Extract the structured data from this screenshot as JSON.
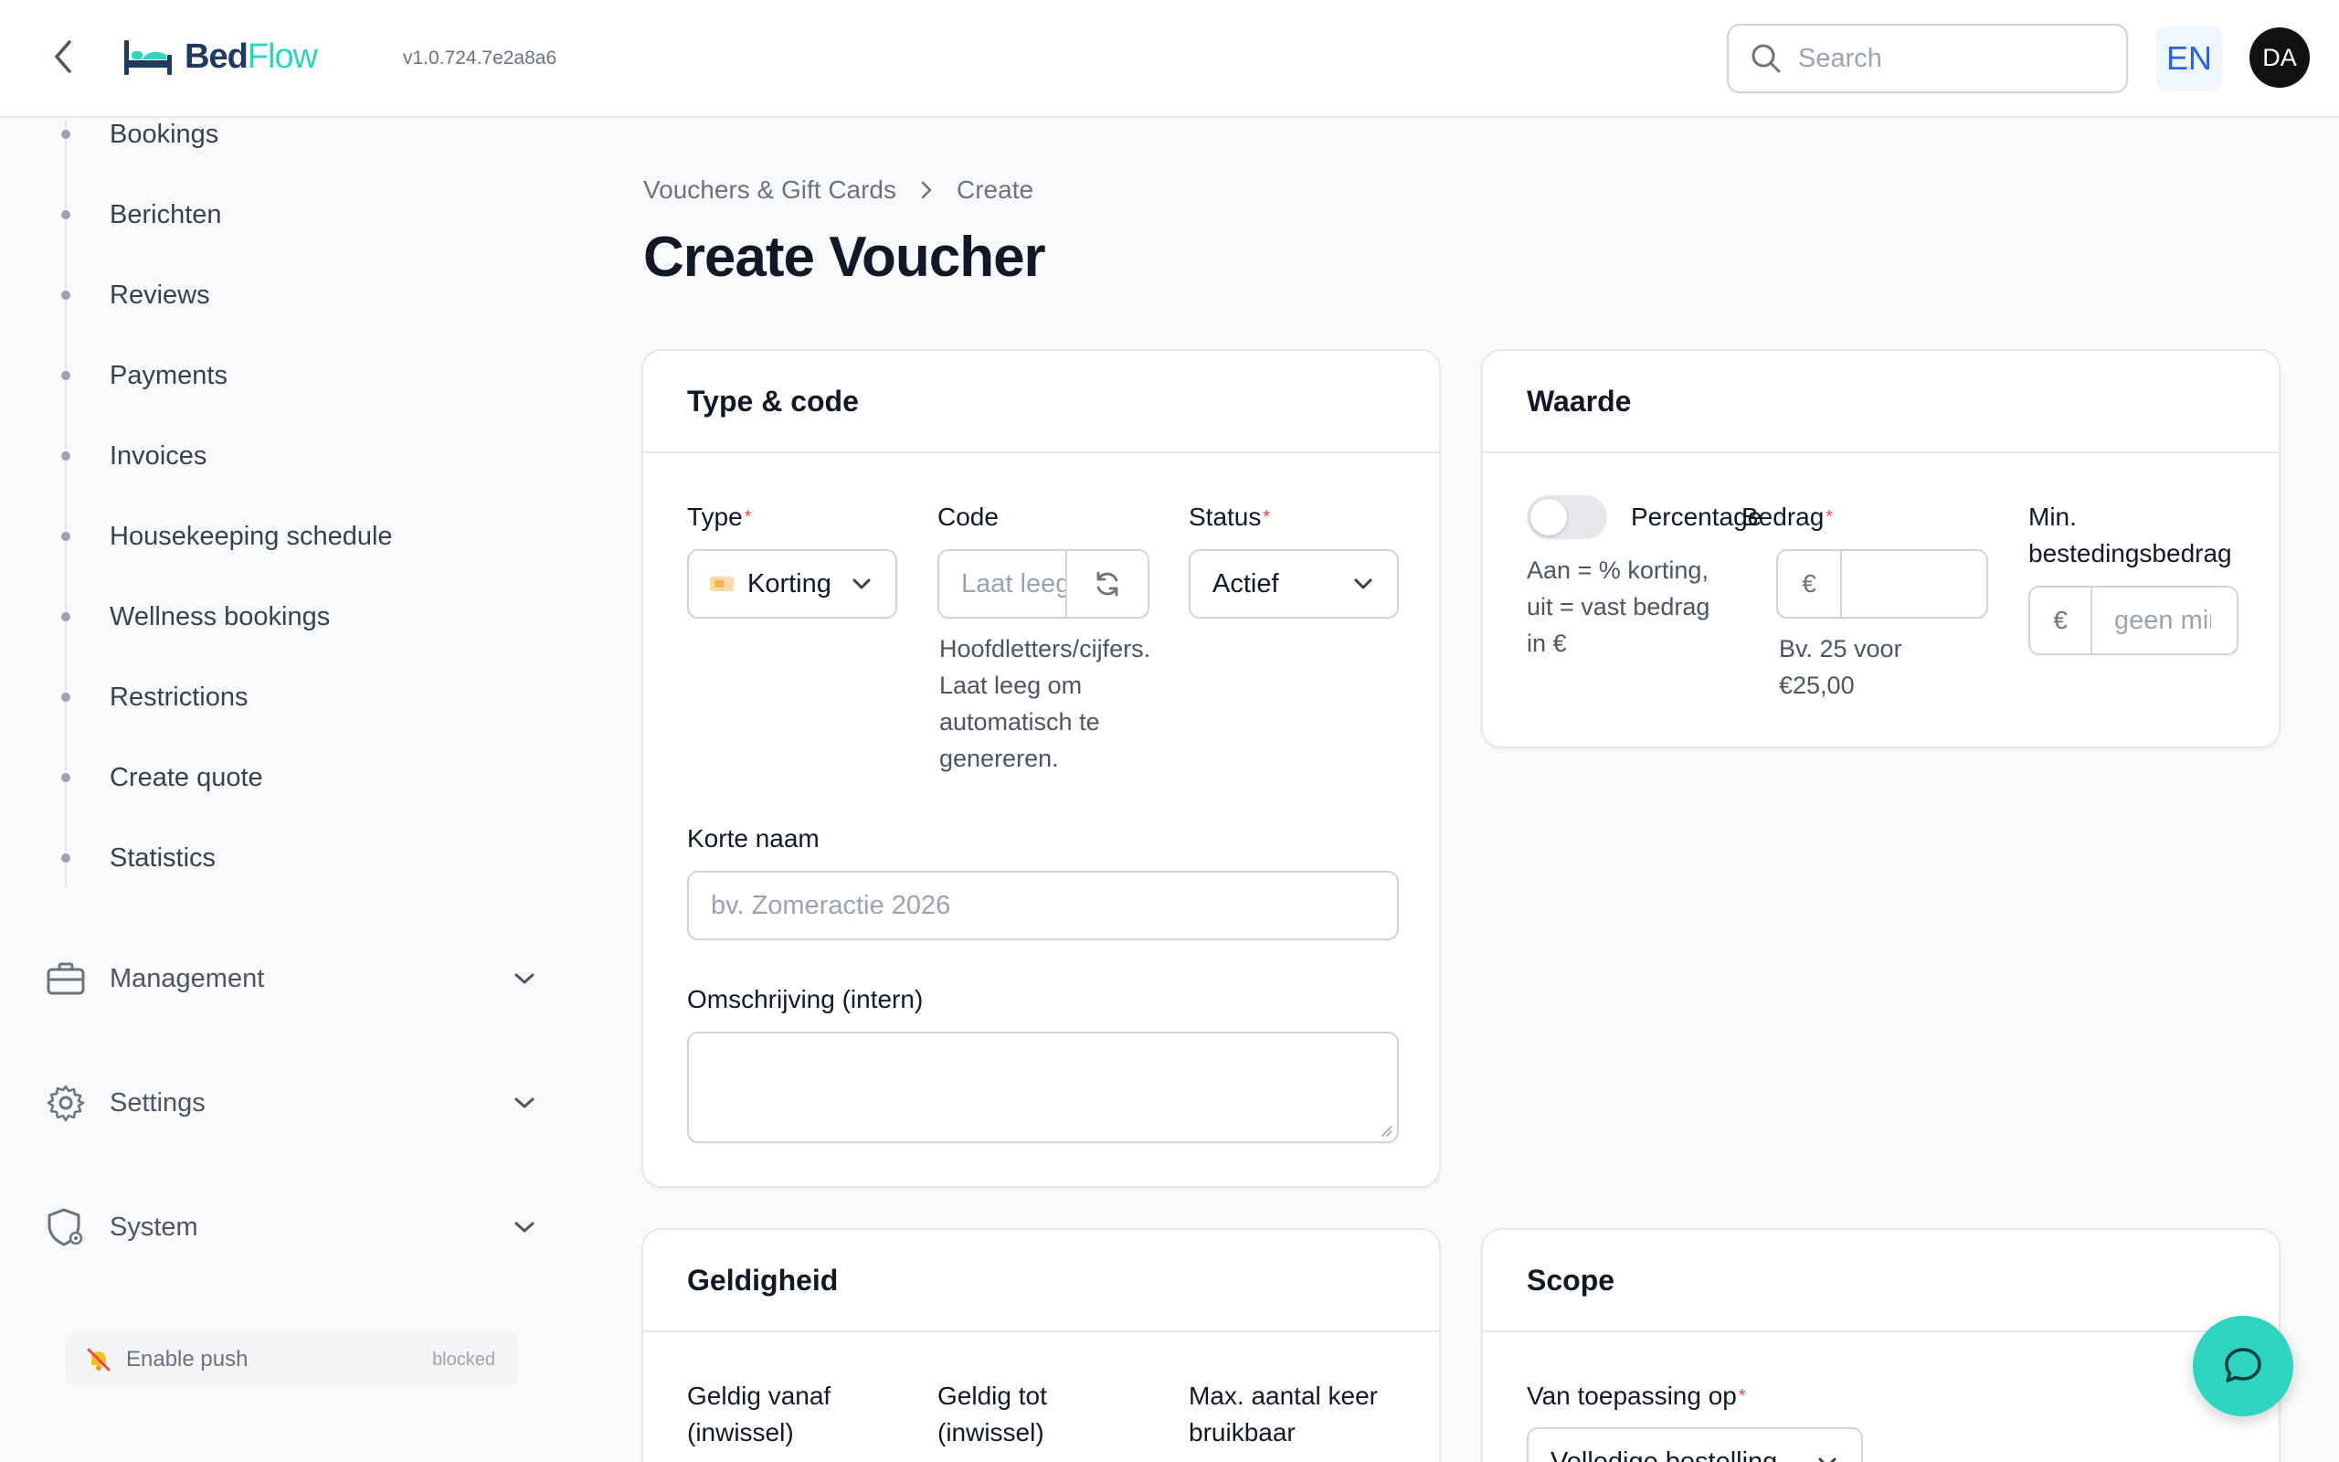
{
  "header": {
    "brand_part1": "Bed",
    "brand_part2": "Flow",
    "version": "v1.0.724.7e2a8a6",
    "search_placeholder": "Search",
    "language": "EN",
    "avatar_initials": "DA"
  },
  "sidebar": {
    "items": [
      {
        "label": "Bookings"
      },
      {
        "label": "Berichten"
      },
      {
        "label": "Reviews"
      },
      {
        "label": "Payments"
      },
      {
        "label": "Invoices"
      },
      {
        "label": "Housekeeping schedule"
      },
      {
        "label": "Wellness bookings"
      },
      {
        "label": "Restrictions"
      },
      {
        "label": "Create quote"
      },
      {
        "label": "Statistics"
      }
    ],
    "groups": [
      {
        "label": "Management",
        "icon": "briefcase-icon"
      },
      {
        "label": "Settings",
        "icon": "gear-icon"
      },
      {
        "label": "System",
        "icon": "shield-gear-icon"
      }
    ],
    "push": {
      "label": "Enable push",
      "state": "blocked"
    }
  },
  "breadcrumb": {
    "parent": "Vouchers & Gift Cards",
    "current": "Create"
  },
  "page_title": "Create Voucher",
  "type_code": {
    "title": "Type & code",
    "type_label": "Type",
    "type_value": "Korting",
    "code_label": "Code",
    "code_placeholder": "Laat leeg",
    "code_hint": [
      "Hoofdletters/cijfers.",
      "Laat leeg om",
      "automatisch te",
      "genereren."
    ],
    "status_label": "Status",
    "status_value": "Actief",
    "short_name_label": "Korte naam",
    "short_name_placeholder": "bv. Zomeractie 2026",
    "description_label": "Omschrijving (intern)"
  },
  "waarde": {
    "title": "Waarde",
    "toggle_label": "Percentage",
    "toggle_hint": [
      "Aan = % korting,",
      "uit = vast bedrag",
      "in €"
    ],
    "toggle_on": false,
    "amount_label": "Bedrag",
    "amount_prefix": "€",
    "amount_hint": [
      "Bv. 25 voor",
      "€25,00"
    ],
    "min_label": [
      "Min.",
      "bestedingsbedrag"
    ],
    "min_prefix": "€",
    "min_placeholder": "geen minimum"
  },
  "geldigheid": {
    "title": "Geldigheid",
    "from_label": [
      "Geldig vanaf",
      "(inwissel)"
    ],
    "to_label": [
      "Geldig tot",
      "(inwissel)"
    ],
    "max_label": [
      "Max. aantal keer",
      "bruikbaar"
    ]
  },
  "scope": {
    "title": "Scope",
    "applies_label": "Van toepassing op",
    "applies_value": "Volledige bestelling"
  },
  "colors": {
    "accent": "#2dd4bf",
    "brand_dark": "#1e3a5f",
    "required": "#ef4444"
  }
}
